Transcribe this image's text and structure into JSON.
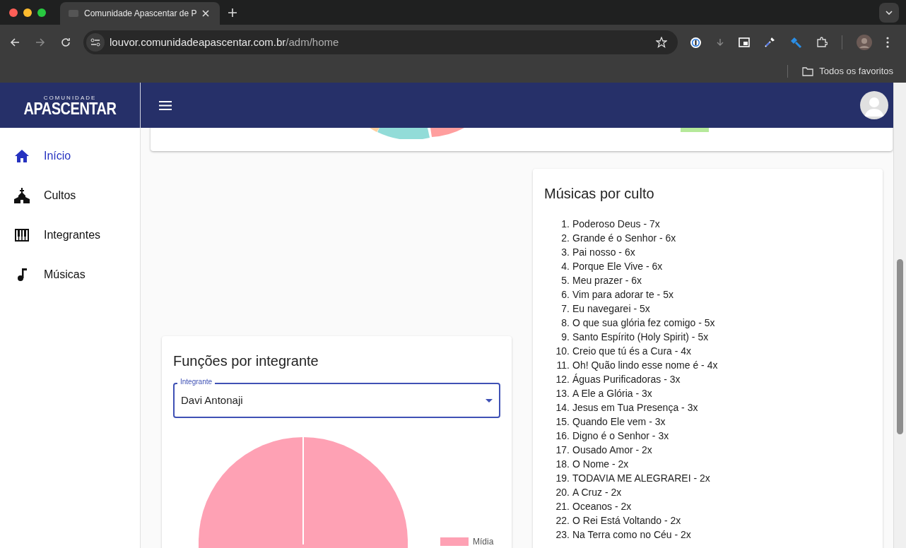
{
  "browser": {
    "tab_title": "Comunidade Apascentar de P",
    "url_host": "louvor.comunidadeapascentar.com.br",
    "url_path": "/adm/home",
    "bookmarks_label": "Todos os favoritos"
  },
  "app": {
    "logo_small": "COMUNIDADE",
    "logo": "APASCENTAR"
  },
  "sidebar": {
    "items": [
      {
        "label": "Início",
        "selected": true
      },
      {
        "label": "Cultos",
        "selected": false
      },
      {
        "label": "Integrantes",
        "selected": false
      },
      {
        "label": "Músicas",
        "selected": false
      }
    ]
  },
  "functions_card": {
    "title": "Funções por integrante",
    "select": {
      "label": "Integrante",
      "value": "Davi Antonaji"
    },
    "legend": [
      {
        "label": "Mídia",
        "color": "#fea1b4"
      }
    ]
  },
  "songs_card": {
    "title": "Músicas por culto",
    "items": [
      {
        "number": "1.",
        "text": "Poderoso Deus - 7x"
      },
      {
        "number": "2.",
        "text": "Grande é o Senhor - 6x"
      },
      {
        "number": "3.",
        "text": "Pai nosso - 6x"
      },
      {
        "number": "4.",
        "text": "Porque Ele Vive - 6x"
      },
      {
        "number": "5.",
        "text": "Meu prazer - 6x"
      },
      {
        "number": "6.",
        "text": "Vim para adorar te - 5x"
      },
      {
        "number": "7.",
        "text": "Eu navegarei - 5x"
      },
      {
        "number": "8.",
        "text": "O que sua glória fez comigo - 5x"
      },
      {
        "number": "9.",
        "text": "Santo Espírito (Holy Spirit) - 5x"
      },
      {
        "number": "10.",
        "text": "Creio que tú és a Cura - 4x"
      },
      {
        "number": "11.",
        "text": "Oh! Quão lindo esse nome é - 4x"
      },
      {
        "number": "12.",
        "text": "Águas Purificadoras - 3x"
      },
      {
        "number": "13.",
        "text": "A Ele a Glória - 3x"
      },
      {
        "number": "14.",
        "text": "Jesus em Tua Presença - 3x"
      },
      {
        "number": "15.",
        "text": "Quando Ele vem - 3x"
      },
      {
        "number": "16.",
        "text": "Digno é o Senhor - 3x"
      },
      {
        "number": "17.",
        "text": "Ousado Amor - 2x"
      },
      {
        "number": "18.",
        "text": "O Nome - 2x"
      },
      {
        "number": "19.",
        "text": "TODAVIA ME ALEGRAREI - 2x"
      },
      {
        "number": "20.",
        "text": "A Cruz - 2x"
      },
      {
        "number": "21.",
        "text": "Oceanos - 2x"
      },
      {
        "number": "22.",
        "text": "O Rei Está Voltando - 2x"
      },
      {
        "number": "23.",
        "text": "Na Terra como no Céu - 2x"
      }
    ]
  }
}
